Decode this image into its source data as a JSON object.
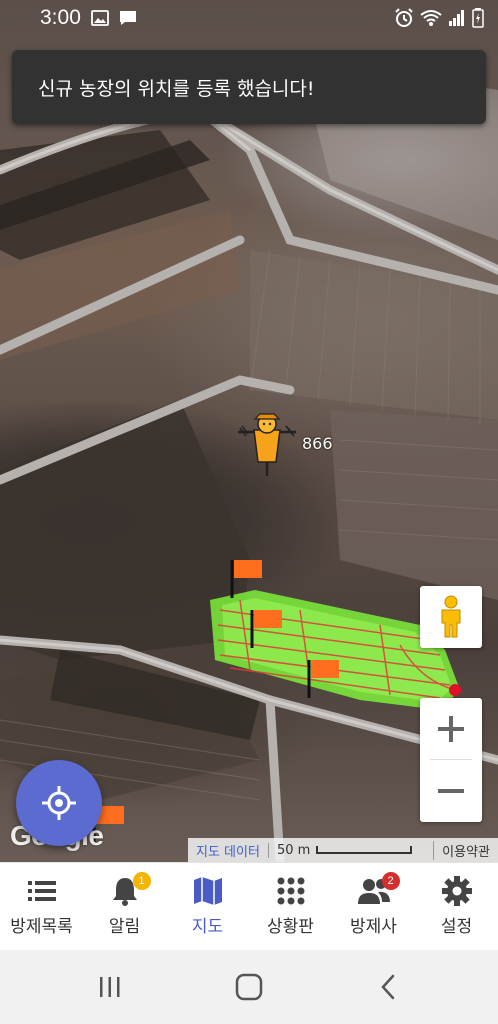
{
  "status_bar": {
    "time": "3:00"
  },
  "toast": {
    "message": "신규 농장의 위치를 등록 했습니다!"
  },
  "map": {
    "marker_label": "866",
    "google_logo": "Google",
    "attribution": {
      "map_data": "지도 데이터",
      "scale": "50 m",
      "terms": "이용약관"
    }
  },
  "nav": {
    "items": [
      {
        "label": "방제목록",
        "icon": "list-icon",
        "badge": ""
      },
      {
        "label": "알림",
        "icon": "bell-icon",
        "badge": "1"
      },
      {
        "label": "지도",
        "icon": "map-icon",
        "badge": ""
      },
      {
        "label": "상황판",
        "icon": "grid-icon",
        "badge": ""
      },
      {
        "label": "방제사",
        "icon": "people-icon",
        "badge": "2"
      },
      {
        "label": "설정",
        "icon": "gear-icon",
        "badge": ""
      }
    ],
    "active_index": 2
  },
  "colors": {
    "accent": "#4a5bc5",
    "fab": "#5b6bd0",
    "badge_yellow": "#f5b400",
    "badge_red": "#d32f2f",
    "flag": "#ff6d1f",
    "coverage": "#7cf03a"
  }
}
